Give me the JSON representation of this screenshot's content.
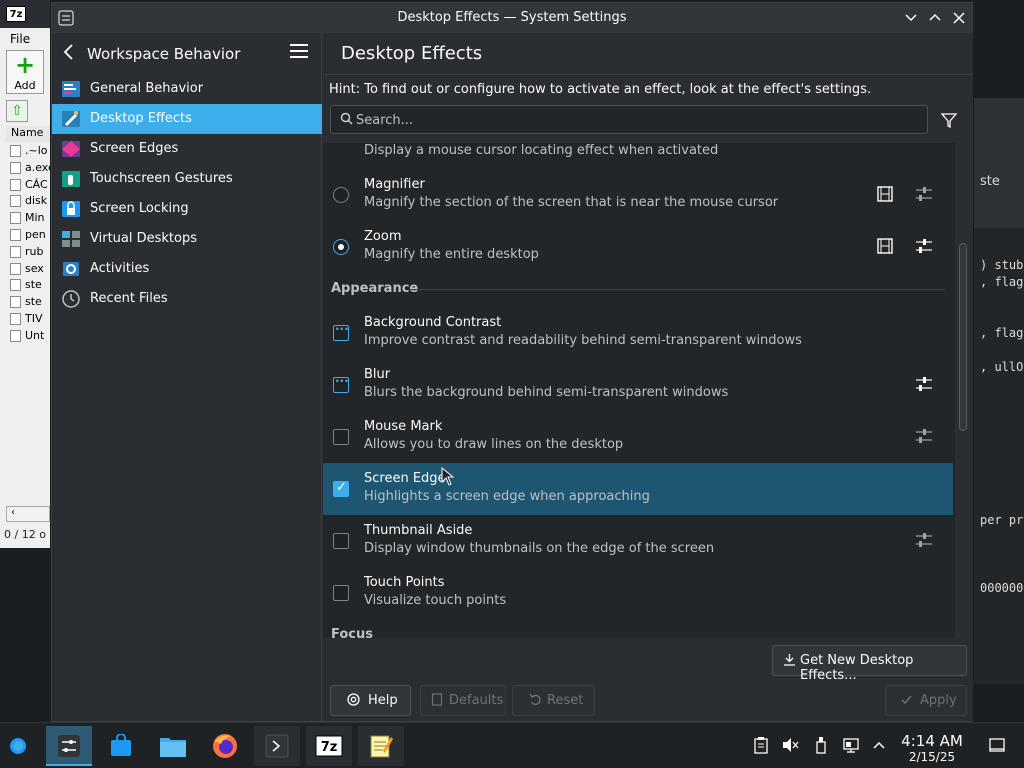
{
  "window": {
    "title": "Desktop Effects — System Settings"
  },
  "sidebar": {
    "back_title": "Workspace Behavior",
    "items": [
      {
        "label": "General Behavior",
        "icon": "general-behavior-icon",
        "color": "#1d99f3"
      },
      {
        "label": "Desktop Effects",
        "icon": "desktop-effects-icon",
        "color": "#1d99f3"
      },
      {
        "label": "Screen Edges",
        "icon": "screen-edges-icon",
        "color": "#e93a9a"
      },
      {
        "label": "Touchscreen Gestures",
        "icon": "touchscreen-gestures-icon",
        "color": "#1cdc9a"
      },
      {
        "label": "Screen Locking",
        "icon": "screen-locking-icon",
        "color": "#3daee9"
      },
      {
        "label": "Virtual Desktops",
        "icon": "virtual-desktops-icon",
        "color": "#4d5257"
      },
      {
        "label": "Activities",
        "icon": "activities-icon",
        "color": "#1d99f3"
      },
      {
        "label": "Recent Files",
        "icon": "recent-files-icon",
        "color": "#7f8c8d"
      }
    ]
  },
  "content": {
    "title": "Desktop Effects",
    "hint": "Hint: To find out or configure how to activate an effect, look at the effect's settings.",
    "search_placeholder": "Search...",
    "effects": {
      "cursor": {
        "desc": "Display a mouse cursor locating effect when activated"
      },
      "magnifier": {
        "name": "Magnifier",
        "desc": "Magnify the section of the screen that is near the mouse cursor",
        "state": "off"
      },
      "zoom": {
        "name": "Zoom",
        "desc": "Magnify the entire desktop",
        "state": "on"
      },
      "appearance_header": "Appearance",
      "background_contrast": {
        "name": "Background Contrast",
        "desc": "Improve contrast and readability behind semi-transparent windows",
        "state": "partial"
      },
      "blur": {
        "name": "Blur",
        "desc": "Blurs the background behind semi-transparent windows",
        "state": "partial"
      },
      "mouse_mark": {
        "name": "Mouse Mark",
        "desc": "Allows you to draw lines on the desktop",
        "state": "unchecked"
      },
      "screen_edge": {
        "name": "Screen Edge",
        "desc": "Highlights a screen edge when approaching",
        "state": "checked"
      },
      "thumbnail_aside": {
        "name": "Thumbnail Aside",
        "desc": "Display window thumbnails on the edge of the screen",
        "state": "unchecked"
      },
      "touch_points": {
        "name": "Touch Points",
        "desc": "Visualize touch points",
        "state": "unchecked"
      },
      "focus_header": "Focus"
    },
    "get_new_label": "Get New Desktop Effects...",
    "help_label": "Help",
    "defaults_label": "Defaults",
    "reset_label": "Reset",
    "apply_label": "Apply"
  },
  "bg7z": {
    "menu": "File",
    "add_label": "Add",
    "col_name": "Name",
    "files": [
      ".~lo",
      "a.exe",
      "CÁC",
      "disk",
      "Min",
      "pen",
      "rub",
      "sex",
      "ste",
      "ste",
      "TIV",
      "Unt"
    ],
    "status": "0 / 12 o"
  },
  "bgterm": {
    "lines": [
      "ste",
      ") stub",
      ", flag",
      ", flag",
      ", ullO",
      "per pr",
      "000000"
    ]
  },
  "taskbar": {
    "time": "4:14 AM",
    "date": "2/15/25"
  },
  "colors": {
    "accent": "#3daee9",
    "selected_row": "#1e5570",
    "window_bg": "#2a2e32"
  }
}
